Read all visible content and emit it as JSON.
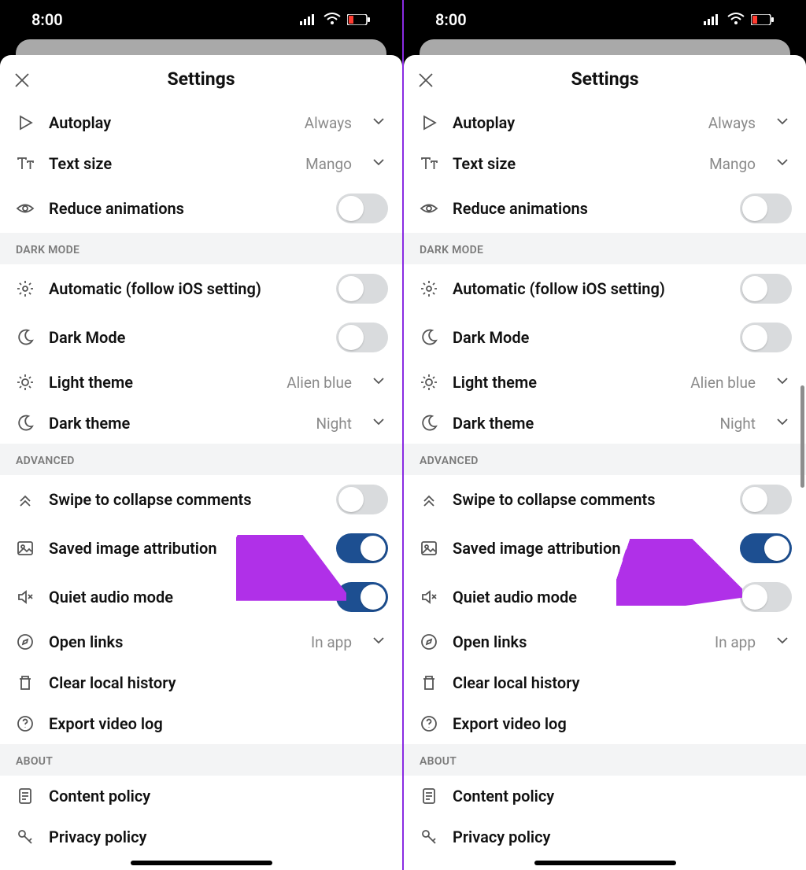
{
  "status": {
    "time": "8:00"
  },
  "header": {
    "title": "Settings"
  },
  "sections": {
    "top": [
      {
        "icon": "play-icon",
        "label": "Autoplay",
        "kind": "picker",
        "value": "Always"
      },
      {
        "icon": "textsize-icon",
        "label": "Text size",
        "kind": "picker",
        "value": "Mango"
      },
      {
        "icon": "eye-icon",
        "label": "Reduce animations",
        "kind": "toggle",
        "on": false
      }
    ],
    "dark_mode_label": "DARK MODE",
    "dark_mode": [
      {
        "icon": "gear-icon",
        "label": "Automatic (follow iOS setting)",
        "kind": "toggle",
        "on": false
      },
      {
        "icon": "moon-icon",
        "label": "Dark Mode",
        "kind": "toggle",
        "on": false
      },
      {
        "icon": "sun-icon",
        "label": "Light theme",
        "kind": "picker",
        "value": "Alien blue"
      },
      {
        "icon": "moon-icon",
        "label": "Dark theme",
        "kind": "picker",
        "value": "Night"
      }
    ],
    "advanced_label": "ADVANCED",
    "advanced": [
      {
        "icon": "collapse-icon",
        "label": "Swipe to collapse comments",
        "kind": "toggle",
        "on": false
      },
      {
        "icon": "image-icon",
        "label": "Saved image attribution",
        "kind": "toggle",
        "on": true
      },
      {
        "icon": "mute-icon",
        "label": "Quiet audio mode",
        "kind": "toggle",
        "on_left": true,
        "on_right": false
      },
      {
        "icon": "compass-icon",
        "label": "Open links",
        "kind": "picker",
        "value": "In app"
      },
      {
        "icon": "trash-icon",
        "label": "Clear local history",
        "kind": "action"
      },
      {
        "icon": "help-icon",
        "label": "Export video log",
        "kind": "action"
      }
    ],
    "about_label": "ABOUT",
    "about": [
      {
        "icon": "doc-icon",
        "label": "Content policy",
        "kind": "action"
      },
      {
        "icon": "key-icon",
        "label": "Privacy policy",
        "kind": "action"
      }
    ]
  },
  "arrow": {
    "color": "#b030e8"
  }
}
